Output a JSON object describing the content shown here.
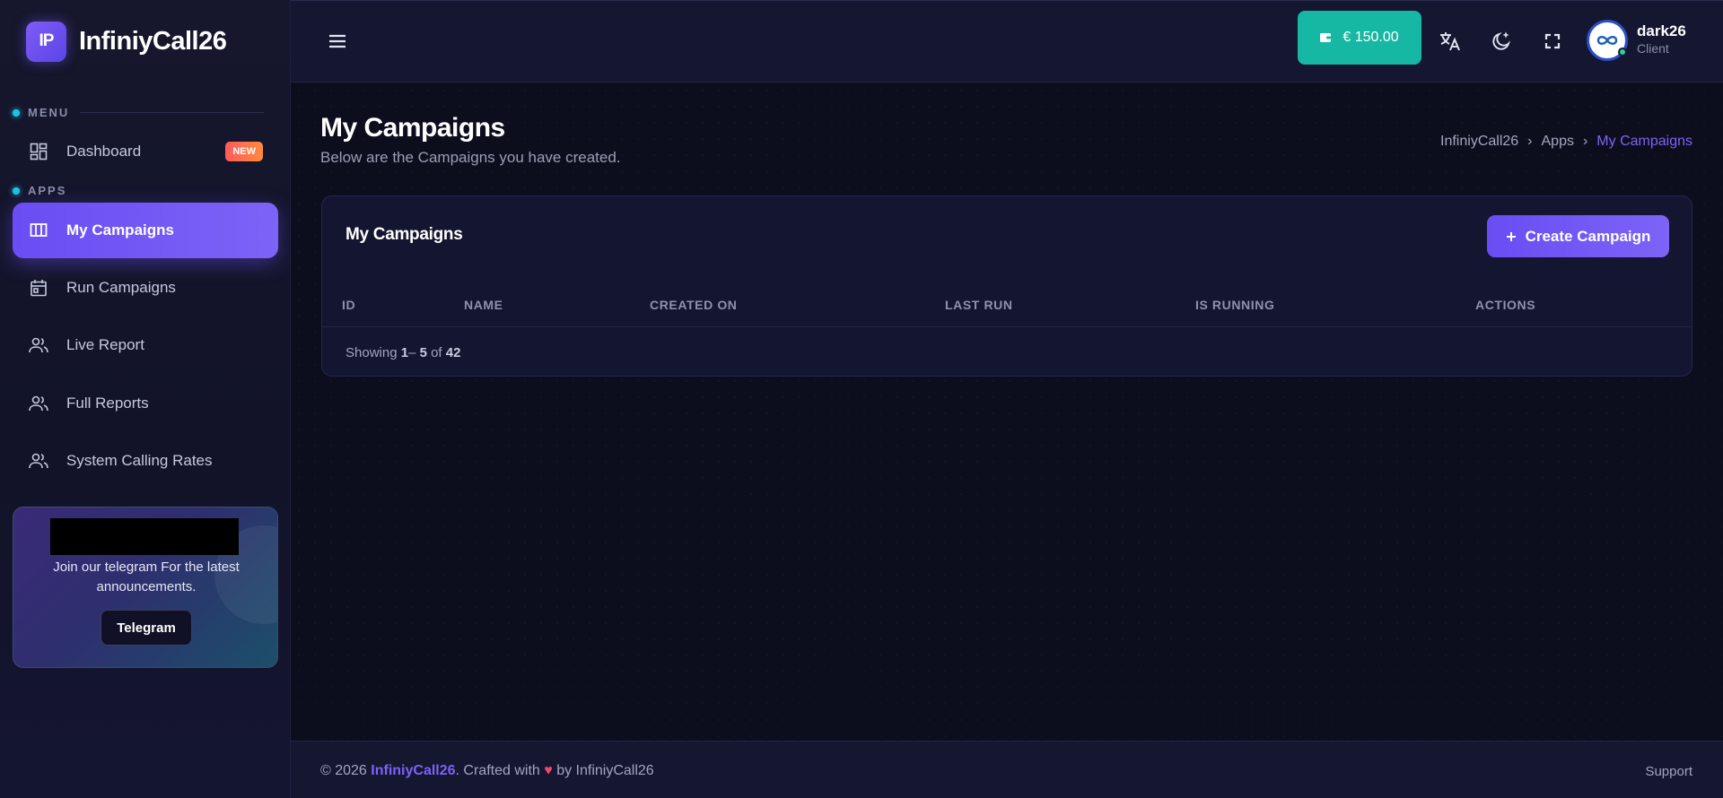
{
  "app": {
    "logo_initials": "IP",
    "name": "InfiniyCall26"
  },
  "sidebar": {
    "menu_label": "MENU",
    "apps_label": "APPS",
    "items": [
      {
        "label": "Dashboard",
        "icon": "dashboard-icon",
        "badge": "NEW"
      },
      {
        "label": "My Campaigns",
        "icon": "columns-icon",
        "active": true
      },
      {
        "label": "Run Campaigns",
        "icon": "calendar-icon"
      },
      {
        "label": "Live Report",
        "icon": "users-icon"
      },
      {
        "label": "Full Reports",
        "icon": "users-icon"
      },
      {
        "label": "System Calling Rates",
        "icon": "users-icon"
      }
    ],
    "promo": {
      "text": "Join our telegram For the latest announcements.",
      "button": "Telegram"
    }
  },
  "topbar": {
    "wallet": "€ 150.00",
    "user": {
      "name": "dark26",
      "role": "Client"
    }
  },
  "page": {
    "title": "My Campaigns",
    "subtitle": "Below are the Campaigns you have created.",
    "breadcrumb": [
      "InfiniyCall26",
      "Apps",
      "My Campaigns"
    ]
  },
  "card": {
    "title": "My Campaigns",
    "create_button": "Create Campaign",
    "columns": [
      "ID",
      "NAME",
      "CREATED ON",
      "LAST RUN",
      "IS RUNNING",
      "ACTIONS"
    ],
    "showing": {
      "prefix": "Showing",
      "from": "1",
      "to": "5",
      "of_label": "of",
      "total": "42"
    }
  },
  "footer": {
    "copyright": "© 2026",
    "brand": "InfiniyCall26",
    "crafted": ". Crafted with",
    "by": "by InfiniyCall26",
    "support": "Support"
  },
  "colors": {
    "accent": "#6a4df4",
    "wallet": "#16b8a3",
    "background": "#0d0e1d"
  }
}
